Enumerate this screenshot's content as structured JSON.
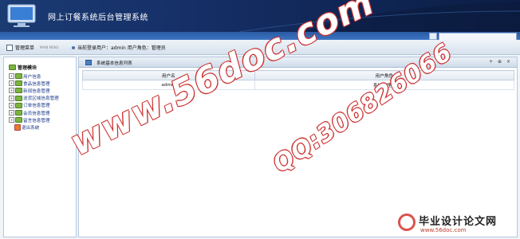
{
  "banner": {
    "title": "网上订餐系统后台管理系统"
  },
  "statusbar": {
    "menu_title": "管理菜单",
    "menu_title_en": "MAIN MENU",
    "current_user": "当前登录用户：admin 用户角色：管理员"
  },
  "sidebar": {
    "root": "管理模块",
    "items": [
      {
        "label": "用户信息"
      },
      {
        "label": "食品信息管理"
      },
      {
        "label": "新闻信息管理"
      },
      {
        "label": "送货区域信息管理"
      },
      {
        "label": "订单信息管理"
      },
      {
        "label": "会员信息管理"
      },
      {
        "label": "留言信息管理"
      },
      {
        "label": "退出系统"
      }
    ]
  },
  "main": {
    "header_title": "系统基本信息列表",
    "tools": "+ ⊕ ×",
    "columns": [
      "用户名",
      "用户角色"
    ],
    "rows": [
      [
        "admin",
        "系统管理员"
      ]
    ]
  },
  "watermarks": {
    "site": "www.56doc.com",
    "qq": "QQ:306826066"
  },
  "footer": {
    "cn": "毕业设计论文网",
    "url": "www.56doc.com"
  },
  "colors": {
    "banner": "#17316a",
    "accent": "#3d74c3",
    "watermark": "#cc3333"
  }
}
